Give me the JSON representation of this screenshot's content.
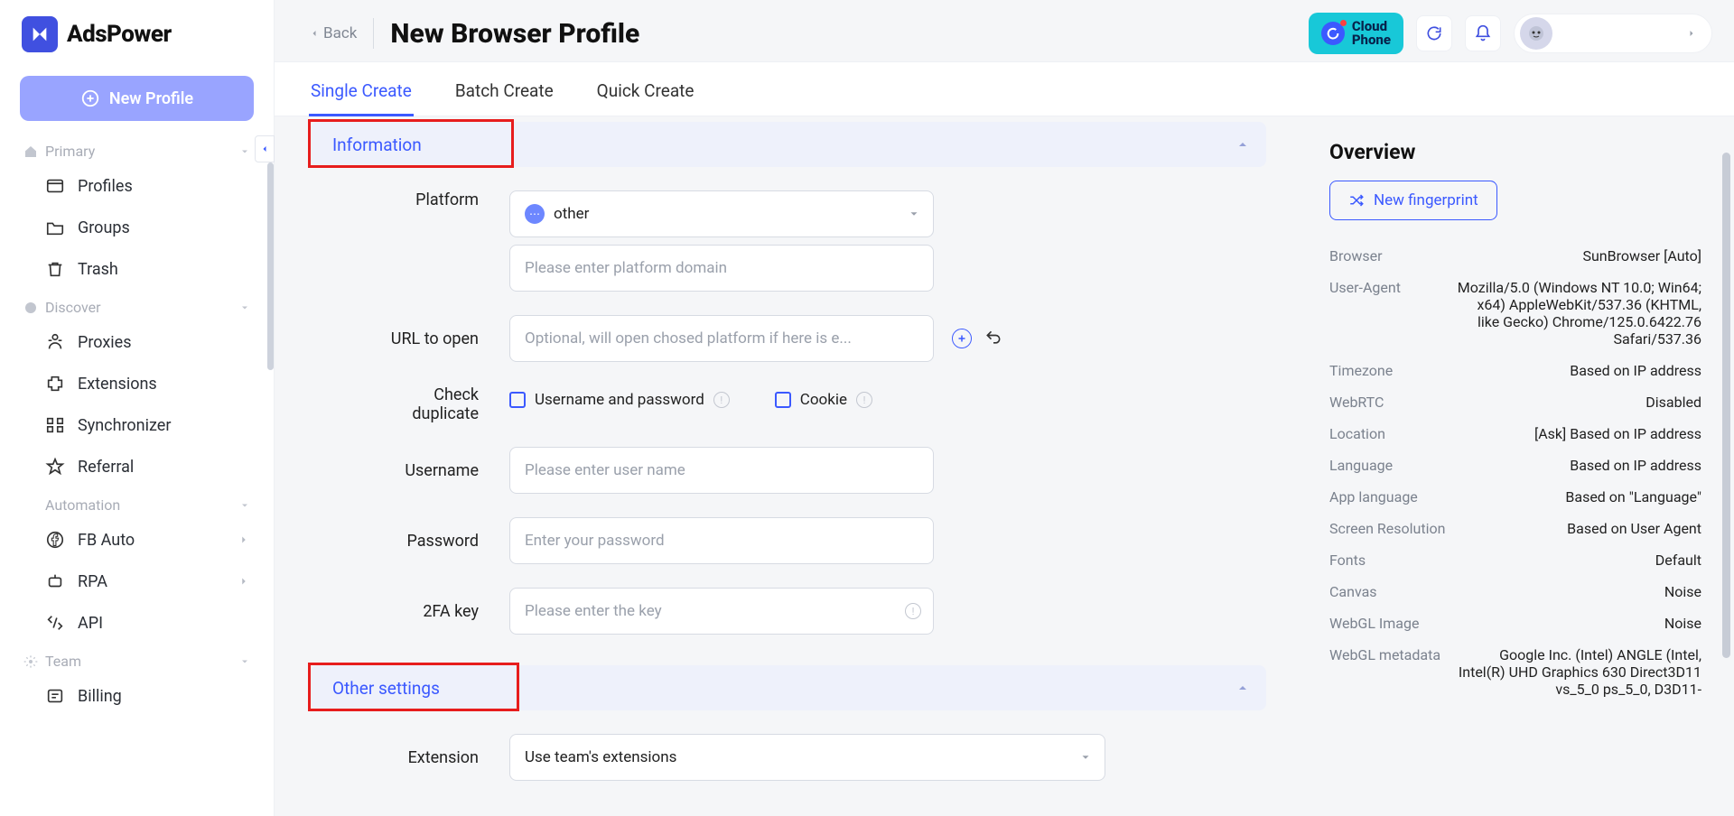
{
  "brand": "AdsPower",
  "sidebar": {
    "newProfile": "New Profile",
    "groups": {
      "primary": {
        "title": "Primary",
        "items": [
          "Profiles",
          "Groups",
          "Trash"
        ]
      },
      "discover": {
        "title": "Discover",
        "items": [
          "Proxies",
          "Extensions",
          "Synchronizer",
          "Referral"
        ]
      },
      "automation": {
        "title": "Automation",
        "items": [
          "FB Auto",
          "RPA",
          "API"
        ]
      },
      "team": {
        "title": "Team",
        "items": [
          "Billing"
        ]
      }
    }
  },
  "header": {
    "back": "Back",
    "title": "New Browser Profile",
    "cloudphone_l1": "Cloud",
    "cloudphone_l2": "Phone"
  },
  "tabs": {
    "single": "Single Create",
    "batch": "Batch Create",
    "quick": "Quick Create"
  },
  "sections": {
    "information": "Information",
    "other": "Other settings"
  },
  "form": {
    "platform_label": "Platform",
    "platform_value": "other",
    "platform_domain_ph": "Please enter platform domain",
    "url_label": "URL to open",
    "url_ph": "Optional, will open chosed platform if here is e...",
    "checkdup_label_l1": "Check",
    "checkdup_label_l2": "duplicate",
    "chk_userpass": "Username and password",
    "chk_cookie": "Cookie",
    "username_label": "Username",
    "username_ph": "Please enter user name",
    "password_label": "Password",
    "password_ph": "Enter your password",
    "tfa_label": "2FA key",
    "tfa_ph": "Please enter the key",
    "extension_label": "Extension",
    "extension_value": "Use team's extensions"
  },
  "overview": {
    "title": "Overview",
    "newfinger": "New fingerprint",
    "rows": [
      {
        "k": "Browser",
        "v": "SunBrowser [Auto]"
      },
      {
        "k": "User-Agent",
        "v": "Mozilla/5.0 (Windows NT 10.0; Win64; x64) AppleWebKit/537.36 (KHTML, like Gecko) Chrome/125.0.6422.76 Safari/537.36"
      },
      {
        "k": "Timezone",
        "v": "Based on IP address"
      },
      {
        "k": "WebRTC",
        "v": "Disabled"
      },
      {
        "k": "Location",
        "v": "[Ask] Based on IP address"
      },
      {
        "k": "Language",
        "v": "Based on IP address"
      },
      {
        "k": "App language",
        "v": "Based on \"Language\""
      },
      {
        "k": "Screen Resolution",
        "v": "Based on User Agent"
      },
      {
        "k": "Fonts",
        "v": "Default"
      },
      {
        "k": "Canvas",
        "v": "Noise"
      },
      {
        "k": "WebGL Image",
        "v": "Noise"
      },
      {
        "k": "WebGL metadata",
        "v": "Google Inc. (Intel) ANGLE (Intel, Intel(R) UHD Graphics 630 Direct3D11 vs_5_0 ps_5_0, D3D11-"
      }
    ]
  }
}
